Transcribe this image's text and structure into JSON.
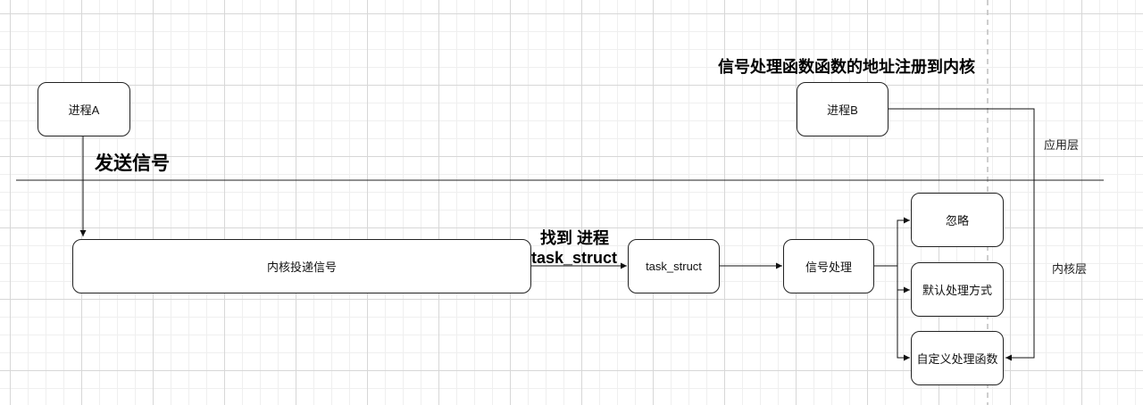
{
  "nodes": {
    "process_a": "进程A",
    "process_b": "进程B",
    "kernel_deliver": "内核投递信号",
    "task_struct": "task_struct",
    "signal_handle": "信号处理",
    "ignore": "忽略",
    "default_handle": "默认处理方式",
    "custom_handler": "自定义处理函数"
  },
  "labels": {
    "register_handler": "信号处理函数函数的地址注册到内核",
    "send_signal": "发送信号",
    "find_process_line1": "找到 进程",
    "find_process_line2": "task_struct",
    "app_layer": "应用层",
    "kernel_layer": "内核层"
  }
}
